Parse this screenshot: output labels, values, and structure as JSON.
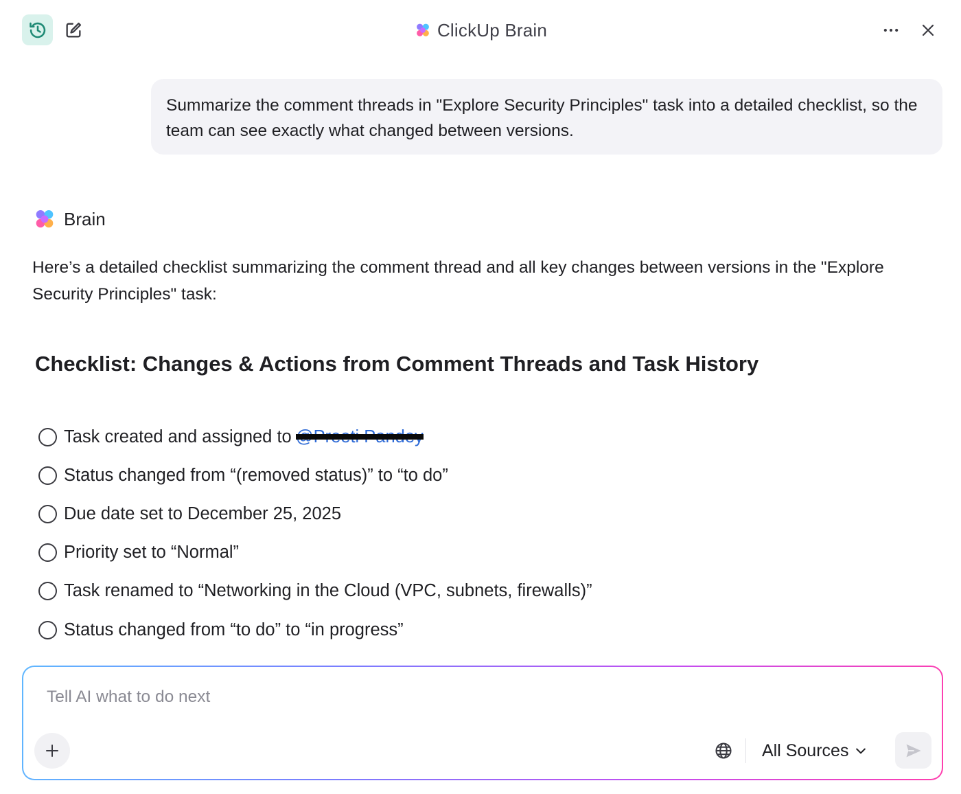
{
  "header": {
    "title": "ClickUp Brain",
    "icons": {
      "history": "history-clock-icon",
      "edit": "edit-icon",
      "logo": "clickup-brain-logo-icon",
      "more": "more-horizontal-icon",
      "close": "close-icon"
    }
  },
  "user_message": {
    "text": "Summarize the comment threads in \"Explore Security Principles\" task into a detailed checklist, so the team can see exactly what changed between versions."
  },
  "response": {
    "author": "Brain",
    "intro": "Here’s a detailed checklist summarizing the comment thread and all key changes between versions in the \"Explore Security Principles\" task:",
    "heading": "Checklist: Changes & Actions from Comment Threads and Task History",
    "checklist": [
      {
        "text": "Task created and assigned to",
        "mention": "@Preeti Pandey",
        "checked": false
      },
      {
        "text": "Status changed from “(removed status)” to “to do”",
        "checked": false
      },
      {
        "text": "Due date set to December 25, 2025",
        "checked": false
      },
      {
        "text": "Priority set to “Normal”",
        "checked": false
      },
      {
        "text": "Task renamed to “Networking in the Cloud (VPC, subnets, firewalls)”",
        "checked": false
      },
      {
        "text": "Status changed from “to do” to “in progress”",
        "checked": false
      }
    ]
  },
  "composer": {
    "placeholder": "Tell AI what to do next",
    "value": "",
    "sources_label": "All Sources",
    "icons": {
      "add": "plus-icon",
      "web": "globe-icon",
      "sources_dropdown": "chevron-down-icon",
      "send": "send-icon"
    }
  },
  "colors": {
    "history_button_bg": "#d9f2ec",
    "history_icon": "#1f8a75",
    "user_bubble_bg": "#f3f3f7",
    "mention": "#2f6bd6",
    "composer_gradient": [
      "#5fb7ff",
      "#7a7cff",
      "#c44cf0",
      "#ff3fae"
    ]
  }
}
